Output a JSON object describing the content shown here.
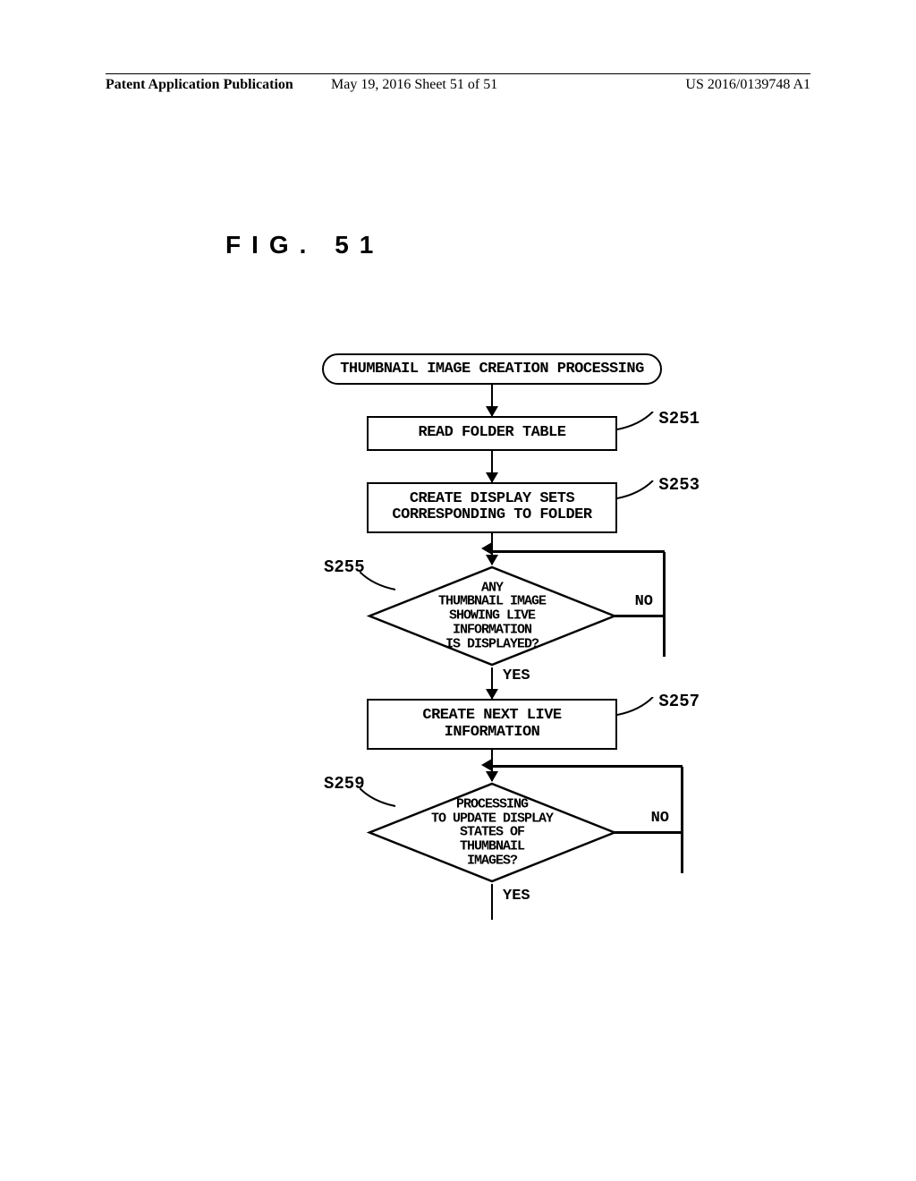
{
  "header": {
    "left": "Patent Application Publication",
    "center": "May 19, 2016  Sheet 51 of 51",
    "right": "US 2016/0139748 A1"
  },
  "figure_title": "FIG. 51",
  "flowchart": {
    "start": "THUMBNAIL IMAGE CREATION PROCESSING",
    "steps": {
      "s251": {
        "label": "S251",
        "text": "READ FOLDER TABLE"
      },
      "s253": {
        "label": "S253",
        "text": "CREATE DISPLAY SETS\nCORRESPONDING TO FOLDER"
      },
      "s255": {
        "label": "S255",
        "text": "ANY\nTHUMBNAIL IMAGE\nSHOWING LIVE INFORMATION\nIS DISPLAYED?"
      },
      "s257": {
        "label": "S257",
        "text": "CREATE NEXT LIVE\nINFORMATION"
      },
      "s259": {
        "label": "S259",
        "text": "PROCESSING\nTO UPDATE DISPLAY\nSTATES OF THUMBNAIL\nIMAGES?"
      }
    },
    "branches": {
      "yes": "YES",
      "no": "NO"
    }
  }
}
